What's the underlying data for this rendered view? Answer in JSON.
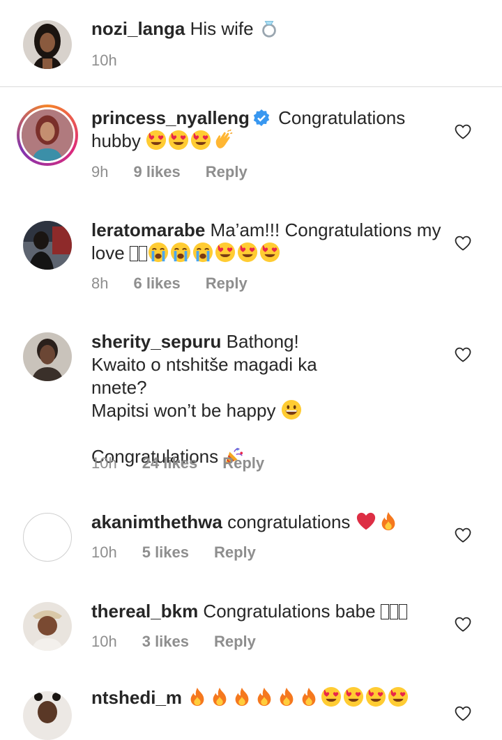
{
  "caption": {
    "username": "nozi_langa",
    "text": "His wife",
    "time": "10h"
  },
  "comments": [
    {
      "username": "princess_nyalleng",
      "verified": true,
      "text": "Congratulations hubby",
      "time": "9h",
      "likes": "9 likes",
      "reply": "Reply"
    },
    {
      "username": "leratomarabe",
      "text": "Ma’am!!! Congratulations my love",
      "time": "8h",
      "likes": "6 likes",
      "reply": "Reply"
    },
    {
      "username": "sherity_sepuru",
      "text_line1": "Bathong! Kwaito o ntshitše magadi ka nnete?",
      "text_line2": "Mapitsi won’t be happy",
      "text_line3": "Congratulations",
      "time": "10h",
      "likes": "24 likes",
      "reply": "Reply"
    },
    {
      "username": "akanimthethwa",
      "text": "congratulations",
      "time": "10h",
      "likes": "5 likes",
      "reply": "Reply"
    },
    {
      "username": "thereal_bkm",
      "text": "Congratulations babe",
      "time": "10h",
      "likes": "3 likes",
      "reply": "Reply"
    },
    {
      "username": "ntshedi_m",
      "text": ""
    }
  ],
  "icons": {
    "like": "heart-outline-icon",
    "verified": "verified-badge-icon"
  },
  "colors": {
    "verified": "#3897f0",
    "meta": "#8e8e8e"
  }
}
